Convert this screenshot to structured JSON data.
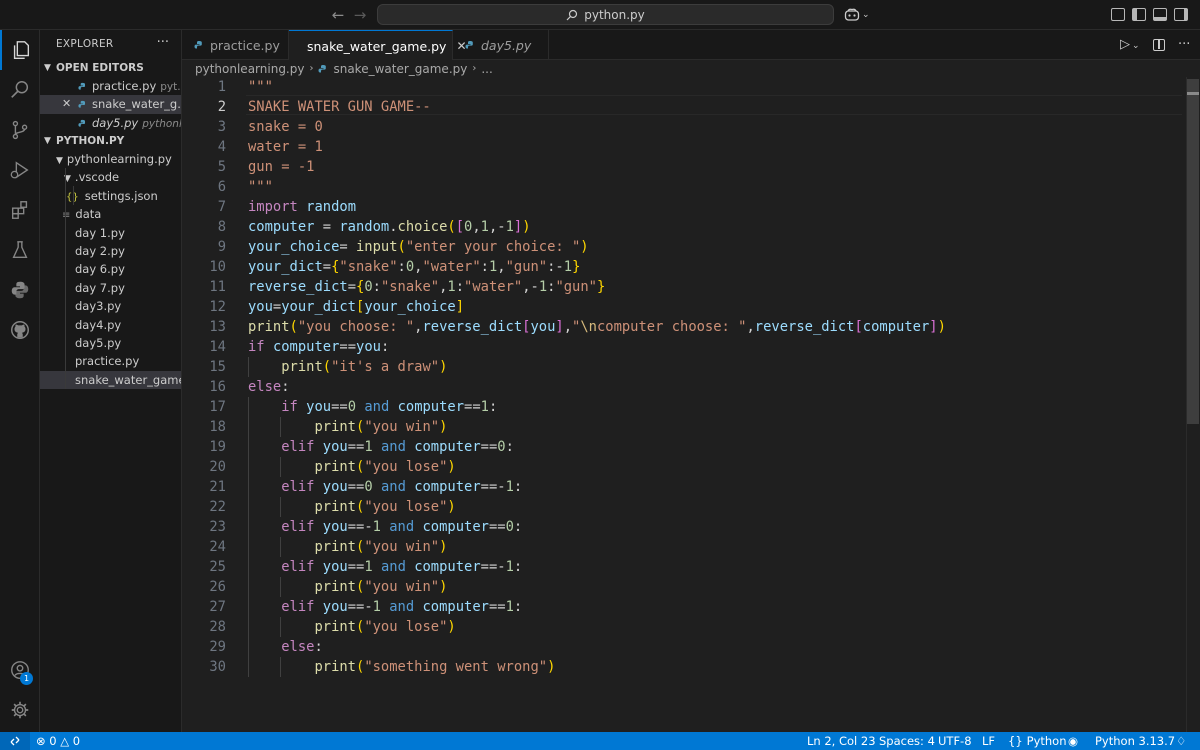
{
  "titlebar": {
    "search_text": "python.py"
  },
  "sidebar": {
    "title": "EXPLORER",
    "open_editors_label": "OPEN EDITORS",
    "open_editors": [
      {
        "name": "practice.py",
        "path": "pyt..."
      },
      {
        "name": "snake_water_g...",
        "path": ""
      },
      {
        "name": "day5.py",
        "path": "pythonl..."
      }
    ],
    "project_label": "PYTHON.PY",
    "folder": "pythonlearning.py",
    "vscode_folder": ".vscode",
    "settings_file": "settings.json",
    "files": [
      "data",
      "day 1.py",
      "day 2.py",
      "day 6.py",
      "day 7.py",
      "day3.py",
      "day4.py",
      "day5.py",
      "practice.py",
      "snake_water_game..."
    ]
  },
  "tabs": [
    {
      "label": "practice.py"
    },
    {
      "label": "snake_water_game.py"
    },
    {
      "label": "day5.py"
    }
  ],
  "breadcrumb": {
    "folder": "pythonlearning.py",
    "file": "snake_water_game.py",
    "tail": "..."
  },
  "editor": {
    "line_numbers": [
      "1",
      "2",
      "3",
      "4",
      "5",
      "6",
      "7",
      "8",
      "9",
      "10",
      "11",
      "12",
      "13",
      "14",
      "15",
      "16",
      "17",
      "18",
      "19",
      "20",
      "21",
      "22",
      "23",
      "24",
      "25",
      "26",
      "27",
      "28",
      "29",
      "30"
    ],
    "lines": [
      "\"\"\"",
      "SNAKE WATER GUN GAME--",
      "snake = 0",
      "water = 1",
      "gun = -1",
      "\"\"\"",
      "import random",
      "computer = random.choice([0,1,-1])",
      "your_choice= input(\"enter your choice: \")",
      "your_dict={\"snake\":0,\"water\":1,\"gun\":-1}",
      "reverse_dict={0:\"snake\",1:\"water\",-1:\"gun\"}",
      "you=your_dict[your_choice]",
      "print(\"you choose: \",reverse_dict[you],\"\\ncomputer choose: \",reverse_dict[computer])",
      "if computer==you:",
      "    print(\"it's a draw\")",
      "else:",
      "    if you==0 and computer==1:",
      "        print(\"you win\")",
      "    elif you==1 and computer==0:",
      "        print(\"you lose\")",
      "    elif you==0 and computer==-1:",
      "        print(\"you lose\")",
      "    elif you==-1 and computer==0:",
      "        print(\"you win\")",
      "    elif you==1 and computer==-1:",
      "        print(\"you win\")",
      "    elif you==-1 and computer==1:",
      "        print(\"you lose\")",
      "    else:",
      "        print(\"something went wrong\")"
    ]
  },
  "statusbar": {
    "errors": "0",
    "warnings": "0",
    "position": "Ln 2, Col 23",
    "spaces": "Spaces: 4",
    "encoding": "UTF-8",
    "eol": "LF",
    "language": "Python",
    "interpreter": "Python 3.13.7"
  },
  "accounts_badge": "1",
  "colors": {
    "accent": "#0078d4",
    "editor_bg": "#1f1f1f",
    "sidebar_bg": "#181818",
    "python_icon": "#519aba"
  }
}
